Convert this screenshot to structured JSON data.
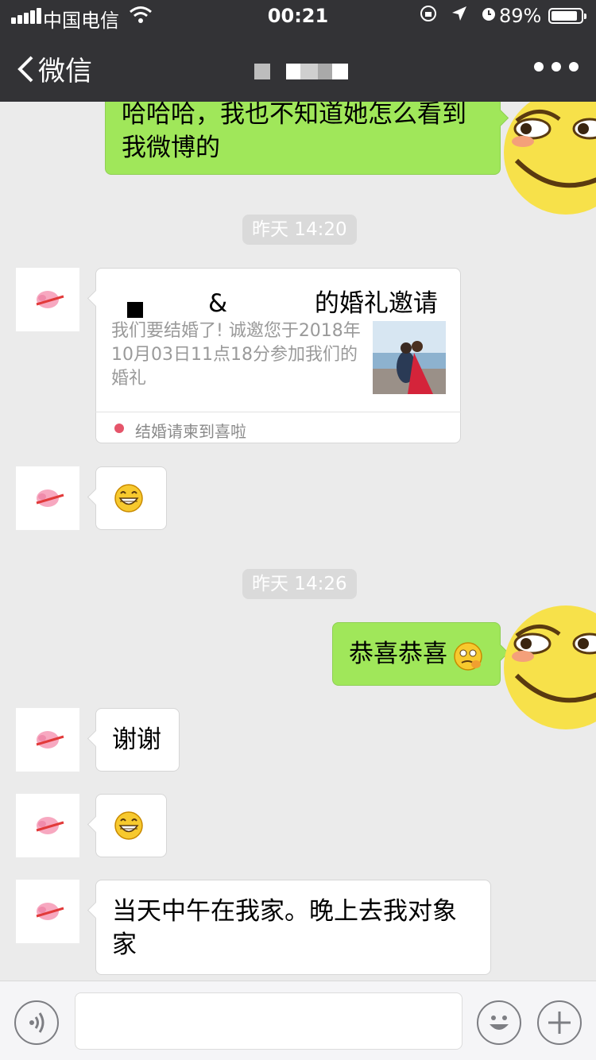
{
  "status_bar": {
    "carrier": "中国电信",
    "time": "00:21",
    "battery": "89%",
    "battery_level": 0.89
  },
  "nav": {
    "back_label": "微信"
  },
  "messages": {
    "m1": "哈哈哈，我也不知道她怎么看到我微博的",
    "ts1": "昨天 14:20",
    "card": {
      "title_partial_1": "&",
      "title_partial_2": "的婚礼邀请",
      "desc": "我们要结婚了! 诚邀您于2018年10月03日11点18分参加我们的婚礼",
      "source": "结婚请柬到喜啦"
    },
    "ts2": "昨天 14:26",
    "m_congrats": "恭喜恭喜",
    "m_thanks": "谢谢",
    "m_last": "当天中午在我家。晚上去我对象家"
  },
  "colors": {
    "green_bubble": "#a0e75a",
    "nav_bg": "#333336",
    "chat_bg": "#ebebeb"
  },
  "icons": {
    "back": "chevron-left-icon",
    "more": "more-dots-icon",
    "voice": "voice-icon",
    "emoji": "emoji-icon",
    "plus": "plus-icon"
  }
}
